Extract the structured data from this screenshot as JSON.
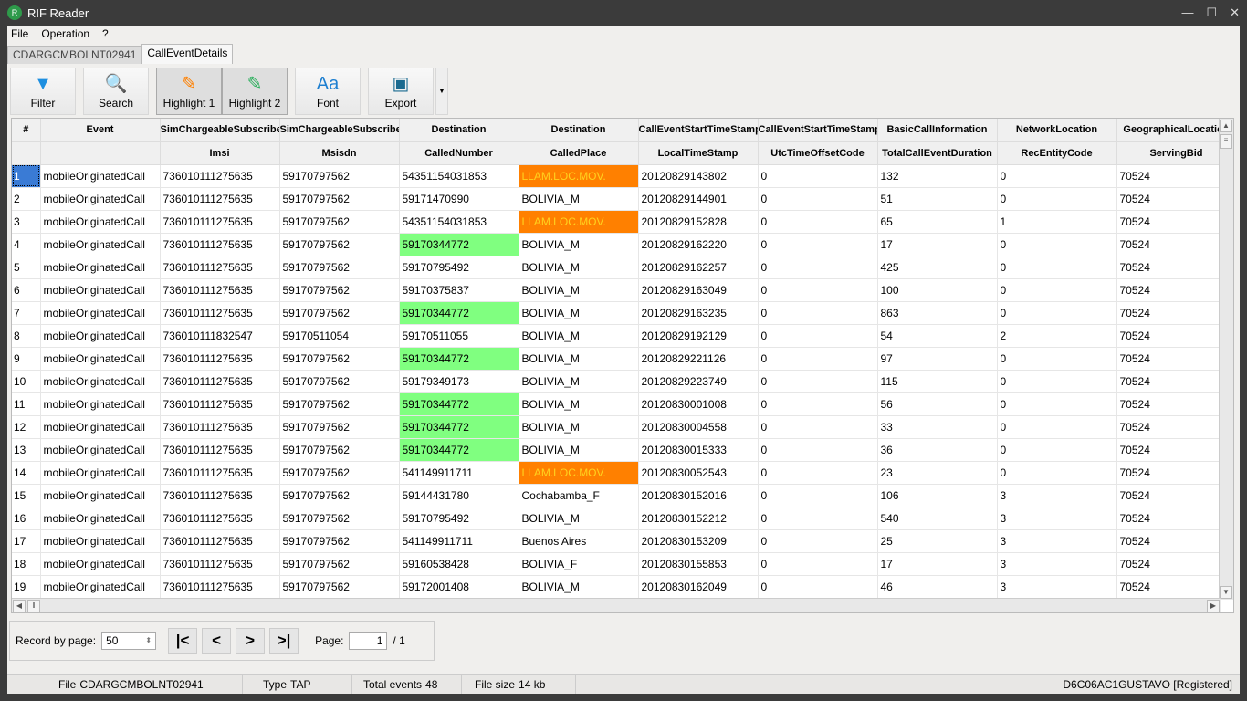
{
  "window": {
    "title": "RIF Reader",
    "icon": "app-logo-icon"
  },
  "menu": [
    "File",
    "Operation",
    "?"
  ],
  "tabs": [
    {
      "label": "CDARGCMBOLNT02941",
      "active": false
    },
    {
      "label": "CallEventDetails",
      "active": true
    }
  ],
  "toolbar": [
    {
      "label": "Filter",
      "icon": "funnel-icon",
      "glyph": "▼",
      "color": "#1e8fe0",
      "pressed": false
    },
    {
      "label": "Search",
      "icon": "magnifier-icon",
      "glyph": "🔍",
      "color": "#2060a0",
      "pressed": false
    },
    {
      "label": "Highlight 1",
      "icon": "highlighter-orange-icon",
      "glyph": "✎",
      "color": "#ff8000",
      "pressed": true
    },
    {
      "label": "Highlight 2",
      "icon": "highlighter-green-icon",
      "glyph": "✎",
      "color": "#30b060",
      "pressed": true
    },
    {
      "label": "Font",
      "icon": "font-icon",
      "glyph": "Aa",
      "color": "#1e7fd0",
      "pressed": false
    },
    {
      "label": "Export",
      "icon": "export-icon",
      "glyph": "▣",
      "color": "#1a6a90",
      "pressed": false
    }
  ],
  "colors": {
    "highlight1_bg": "#ff8000",
    "highlight1_text": "#ffd21e",
    "highlight2_bg": "#80ff80",
    "selection": "#3a7bd5"
  },
  "grid": {
    "header_top": [
      "#",
      "Event",
      "SimChargeableSubscriber",
      "SimChargeableSubscriber",
      "Destination",
      "Destination",
      "CallEventStartTimeStamp",
      "CallEventStartTimeStamp",
      "BasicCallInformation",
      "NetworkLocation",
      "GeographicalLocation"
    ],
    "header_bottom": [
      "",
      "",
      "Imsi",
      "Msisdn",
      "CalledNumber",
      "CalledPlace",
      "LocalTimeStamp",
      "UtcTimeOffsetCode",
      "TotalCallEventDuration",
      "RecEntityCode",
      "ServingBid"
    ],
    "rows": [
      {
        "cells": [
          "1",
          "mobileOriginatedCall",
          "736010111275635",
          "59170797562",
          "54351154031853",
          "LLAM.LOC.MOV.",
          "20120829143802",
          "0",
          "132",
          "0",
          "70524"
        ],
        "hl_place": true,
        "selected": true
      },
      {
        "cells": [
          "2",
          "mobileOriginatedCall",
          "736010111275635",
          "59170797562",
          "59171470990",
          "BOLIVIA_M",
          "20120829144901",
          "0",
          "51",
          "0",
          "70524"
        ]
      },
      {
        "cells": [
          "3",
          "mobileOriginatedCall",
          "736010111275635",
          "59170797562",
          "54351154031853",
          "LLAM.LOC.MOV.",
          "20120829152828",
          "0",
          "65",
          "1",
          "70524"
        ],
        "hl_place": true
      },
      {
        "cells": [
          "4",
          "mobileOriginatedCall",
          "736010111275635",
          "59170797562",
          "59170344772",
          "BOLIVIA_M",
          "20120829162220",
          "0",
          "17",
          "0",
          "70524"
        ],
        "hl_number": true
      },
      {
        "cells": [
          "5",
          "mobileOriginatedCall",
          "736010111275635",
          "59170797562",
          "59170795492",
          "BOLIVIA_M",
          "20120829162257",
          "0",
          "425",
          "0",
          "70524"
        ]
      },
      {
        "cells": [
          "6",
          "mobileOriginatedCall",
          "736010111275635",
          "59170797562",
          "59170375837",
          "BOLIVIA_M",
          "20120829163049",
          "0",
          "100",
          "0",
          "70524"
        ]
      },
      {
        "cells": [
          "7",
          "mobileOriginatedCall",
          "736010111275635",
          "59170797562",
          "59170344772",
          "BOLIVIA_M",
          "20120829163235",
          "0",
          "863",
          "0",
          "70524"
        ],
        "hl_number": true
      },
      {
        "cells": [
          "8",
          "mobileOriginatedCall",
          "736010111832547",
          "59170511054",
          "59170511055",
          "BOLIVIA_M",
          "20120829192129",
          "0",
          "54",
          "2",
          "70524"
        ]
      },
      {
        "cells": [
          "9",
          "mobileOriginatedCall",
          "736010111275635",
          "59170797562",
          "59170344772",
          "BOLIVIA_M",
          "20120829221126",
          "0",
          "97",
          "0",
          "70524"
        ],
        "hl_number": true
      },
      {
        "cells": [
          "10",
          "mobileOriginatedCall",
          "736010111275635",
          "59170797562",
          "59179349173",
          "BOLIVIA_M",
          "20120829223749",
          "0",
          "115",
          "0",
          "70524"
        ]
      },
      {
        "cells": [
          "11",
          "mobileOriginatedCall",
          "736010111275635",
          "59170797562",
          "59170344772",
          "BOLIVIA_M",
          "20120830001008",
          "0",
          "56",
          "0",
          "70524"
        ],
        "hl_number": true
      },
      {
        "cells": [
          "12",
          "mobileOriginatedCall",
          "736010111275635",
          "59170797562",
          "59170344772",
          "BOLIVIA_M",
          "20120830004558",
          "0",
          "33",
          "0",
          "70524"
        ],
        "hl_number": true
      },
      {
        "cells": [
          "13",
          "mobileOriginatedCall",
          "736010111275635",
          "59170797562",
          "59170344772",
          "BOLIVIA_M",
          "20120830015333",
          "0",
          "36",
          "0",
          "70524"
        ],
        "hl_number": true
      },
      {
        "cells": [
          "14",
          "mobileOriginatedCall",
          "736010111275635",
          "59170797562",
          "541149911711",
          "LLAM.LOC.MOV.",
          "20120830052543",
          "0",
          "23",
          "0",
          "70524"
        ],
        "hl_place": true
      },
      {
        "cells": [
          "15",
          "mobileOriginatedCall",
          "736010111275635",
          "59170797562",
          "59144431780",
          "Cochabamba_F",
          "20120830152016",
          "0",
          "106",
          "3",
          "70524"
        ]
      },
      {
        "cells": [
          "16",
          "mobileOriginatedCall",
          "736010111275635",
          "59170797562",
          "59170795492",
          "BOLIVIA_M",
          "20120830152212",
          "0",
          "540",
          "3",
          "70524"
        ]
      },
      {
        "cells": [
          "17",
          "mobileOriginatedCall",
          "736010111275635",
          "59170797562",
          "541149911711",
          "Buenos Aires",
          "20120830153209",
          "0",
          "25",
          "3",
          "70524"
        ]
      },
      {
        "cells": [
          "18",
          "mobileOriginatedCall",
          "736010111275635",
          "59170797562",
          "59160538428",
          "BOLIVIA_F",
          "20120830155853",
          "0",
          "17",
          "3",
          "70524"
        ]
      },
      {
        "cells": [
          "19",
          "mobileOriginatedCall",
          "736010111275635",
          "59170797562",
          "59172001408",
          "BOLIVIA_M",
          "20120830162049",
          "0",
          "46",
          "3",
          "70524"
        ]
      }
    ]
  },
  "pager": {
    "record_label": "Record by page:",
    "record_value": "50",
    "first": "|<",
    "prev": "<",
    "next": ">",
    "last": ">|",
    "page_label": "Page:",
    "page_value": "1",
    "page_total": "/ 1"
  },
  "status": {
    "file_label": "File",
    "file_value": "CDARGCMBOLNT02941",
    "type_label": "Type",
    "type_value": "TAP",
    "events_label": "Total events",
    "events_value": "48",
    "size_label": "File size",
    "size_value": "14 kb",
    "registration": "D6C06AC1GUSTAVO [Registered]"
  }
}
